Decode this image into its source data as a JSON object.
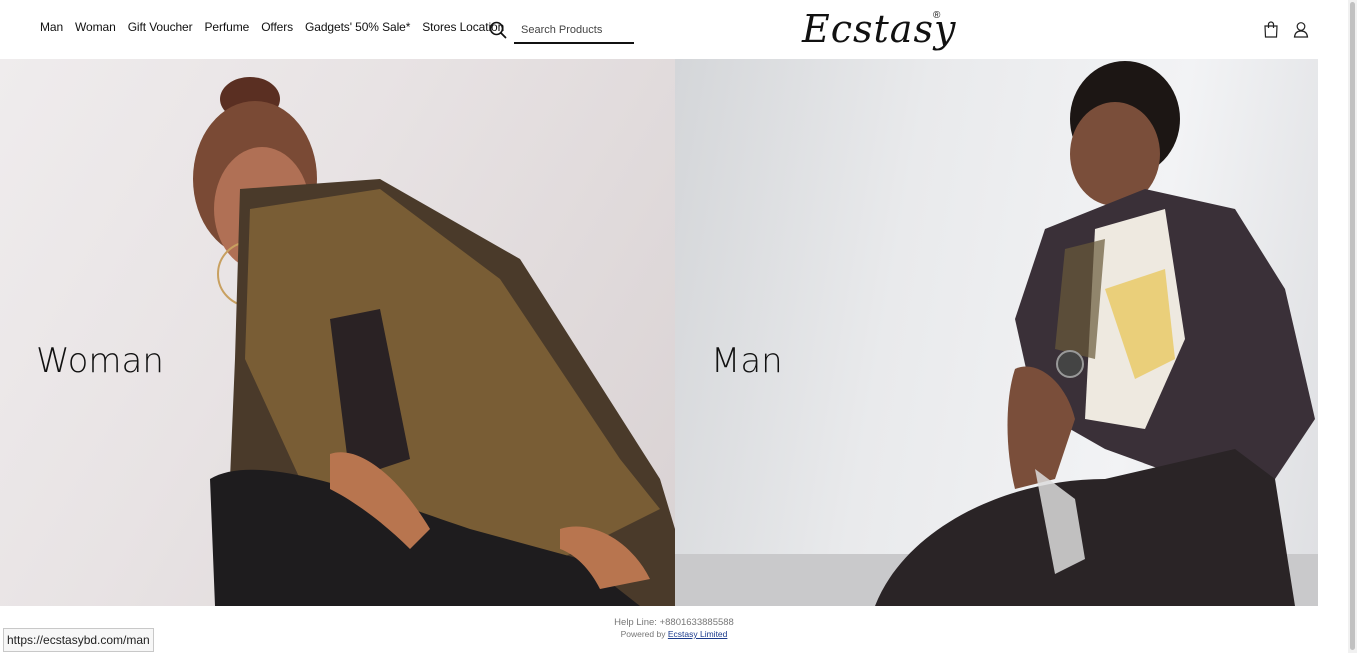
{
  "nav": [
    "Man",
    "Woman",
    "Gift Voucher",
    "Perfume",
    "Offers",
    "Gadgets' 50% Sale*",
    "Stores Location"
  ],
  "search": {
    "placeholder": "Search Products"
  },
  "logo": {
    "text": "Ecstasy",
    "mark": "®"
  },
  "panels": {
    "woman": "Woman",
    "man": "Man"
  },
  "footer": {
    "helpline": "Help Line: +8801633885588",
    "powered_prefix": "Powered by",
    "powered_link": "Ecstasy Limited"
  },
  "status_url": "https://ecstasybd.com/man"
}
